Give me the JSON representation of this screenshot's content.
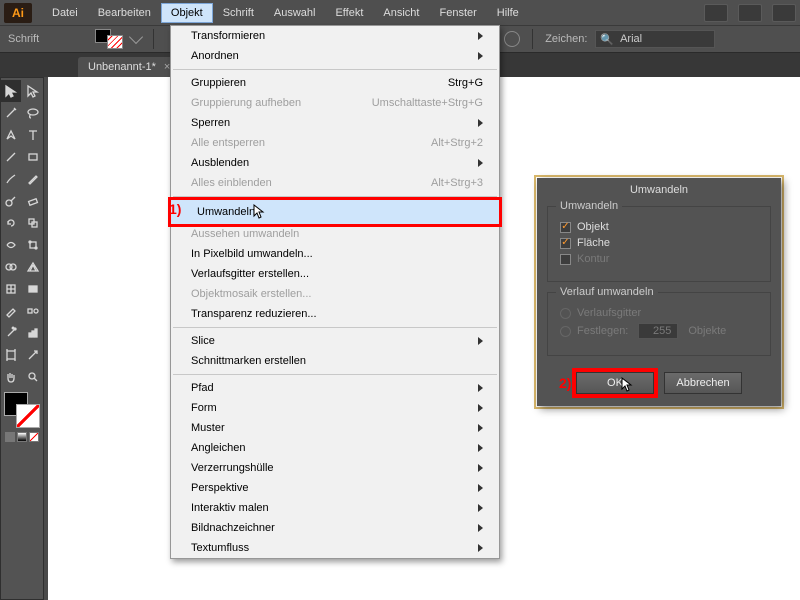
{
  "app_logo": "Ai",
  "menubar": [
    "Datei",
    "Bearbeiten",
    "Objekt",
    "Schrift",
    "Auswahl",
    "Effekt",
    "Ansicht",
    "Fenster",
    "Hilfe"
  ],
  "active_menu_index": 2,
  "options": {
    "left_label": "Schrift",
    "zeichen_label": "Zeichen:",
    "font_value": "Arial"
  },
  "doc_tab": "Unbenannt-1*",
  "tools": [
    [
      "selection",
      "direct-selection"
    ],
    [
      "magic-wand",
      "lasso"
    ],
    [
      "pen",
      "type"
    ],
    [
      "line-segment",
      "rectangle"
    ],
    [
      "paintbrush",
      "pencil"
    ],
    [
      "blob-brush",
      "eraser"
    ],
    [
      "rotate",
      "scale"
    ],
    [
      "width",
      "free-transform"
    ],
    [
      "shape-builder",
      "perspective-grid"
    ],
    [
      "mesh",
      "gradient"
    ],
    [
      "eyedropper",
      "blend"
    ],
    [
      "symbol-sprayer",
      "column-graph"
    ],
    [
      "artboard",
      "slice"
    ],
    [
      "hand",
      "zoom"
    ]
  ],
  "menu": {
    "items": [
      {
        "label": "Transformieren",
        "sub": true
      },
      {
        "label": "Anordnen",
        "sub": true
      },
      {
        "sep": true
      },
      {
        "label": "Gruppieren",
        "shortcut": "Strg+G"
      },
      {
        "label": "Gruppierung aufheben",
        "shortcut": "Umschalttaste+Strg+G",
        "disabled": true
      },
      {
        "label": "Sperren",
        "sub": true
      },
      {
        "label": "Alle entsperren",
        "shortcut": "Alt+Strg+2",
        "disabled": true
      },
      {
        "label": "Ausblenden",
        "sub": true
      },
      {
        "label": "Alles einblenden",
        "shortcut": "Alt+Strg+3",
        "disabled": true
      },
      {
        "sep": true
      },
      {
        "label": "Umwandeln",
        "highlight": true
      },
      {
        "label": "Aussehen umwandeln",
        "disabled": true
      },
      {
        "label": "In Pixelbild umwandeln..."
      },
      {
        "label": "Verlaufsgitter erstellen..."
      },
      {
        "label": "Objektmosaik erstellen...",
        "disabled": true
      },
      {
        "label": "Transparenz reduzieren..."
      },
      {
        "sep": true
      },
      {
        "label": "Slice",
        "sub": true
      },
      {
        "label": "Schnittmarken erstellen"
      },
      {
        "sep": true
      },
      {
        "label": "Pfad",
        "sub": true
      },
      {
        "label": "Form",
        "sub": true
      },
      {
        "label": "Muster",
        "sub": true
      },
      {
        "label": "Angleichen",
        "sub": true
      },
      {
        "label": "Verzerrungshülle",
        "sub": true
      },
      {
        "label": "Perspektive",
        "sub": true
      },
      {
        "label": "Interaktiv malen",
        "sub": true
      },
      {
        "label": "Bildnachzeichner",
        "sub": true
      },
      {
        "label": "Textumfluss",
        "sub": true
      }
    ],
    "callout": "1)"
  },
  "dialog": {
    "title": "Umwandeln",
    "group1_label": "Umwandeln",
    "cb_objekt": "Objekt",
    "cb_flaeche": "Fläche",
    "cb_kontur": "Kontur",
    "group2_label": "Verlauf umwandeln",
    "rb_gitter": "Verlaufsgitter",
    "rb_festlegen": "Festlegen:",
    "festlegen_value": "255",
    "festlegen_suffix": "Objekte",
    "ok": "OK",
    "cancel": "Abbrechen",
    "callout": "2)"
  }
}
